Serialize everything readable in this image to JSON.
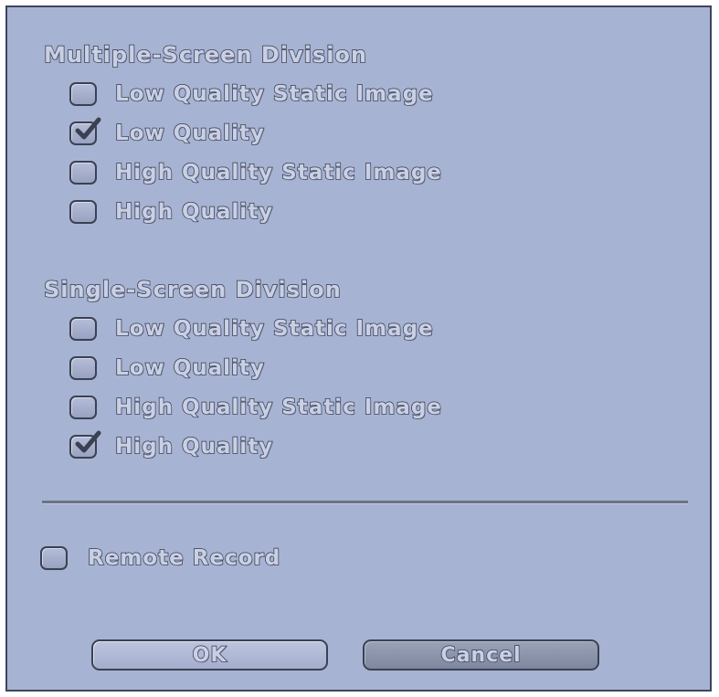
{
  "multiple_screen": {
    "title": "Multiple-Screen Division",
    "options": [
      {
        "label": "Low Quality Static Image",
        "checked": false
      },
      {
        "label": "Low Quality",
        "checked": true
      },
      {
        "label": "High Quality Static Image",
        "checked": false
      },
      {
        "label": "High Quality",
        "checked": false
      }
    ]
  },
  "single_screen": {
    "title": "Single-Screen Division",
    "options": [
      {
        "label": "Low Quality Static Image",
        "checked": false
      },
      {
        "label": "Low Quality",
        "checked": false
      },
      {
        "label": "High Quality Static Image",
        "checked": false
      },
      {
        "label": "High Quality",
        "checked": true
      }
    ]
  },
  "remote_record": {
    "label": "Remote Record",
    "checked": false
  },
  "buttons": {
    "ok": "OK",
    "cancel": "Cancel"
  },
  "colors": {
    "dialog_bg": "#a7b3d3",
    "text_fill": "#c9d0e6",
    "text_outline": "#34394a"
  }
}
